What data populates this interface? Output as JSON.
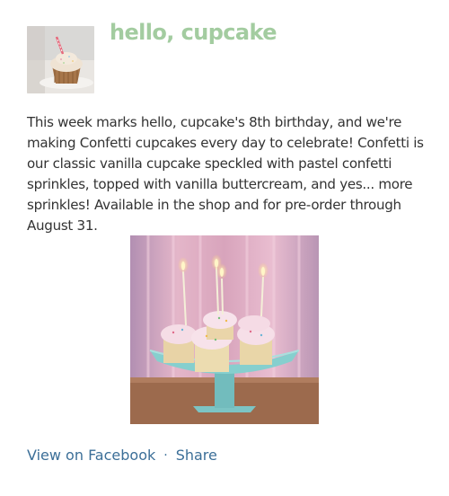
{
  "post": {
    "page_name": "hello, cupcake",
    "message": "This week marks hello, cupcake's 8th birthday, and we're making Confetti cupcakes every day to celebrate! Confetti is our classic vanilla cupcake speckled with pastel confetti sprinkles, topped with vanilla buttercream, and yes... more sprinkles! Available in the shop and for pre-order through August 31.",
    "avatar_icon": "cupcake-profile-photo",
    "photo_icon": "birthday-cupcakes-photo"
  },
  "actions": {
    "view_label": "View on Facebook",
    "separator": "·",
    "share_label": "Share"
  },
  "colors": {
    "brand_green": "#a3cca0",
    "link_blue": "#3c6f98",
    "text": "#333333"
  }
}
